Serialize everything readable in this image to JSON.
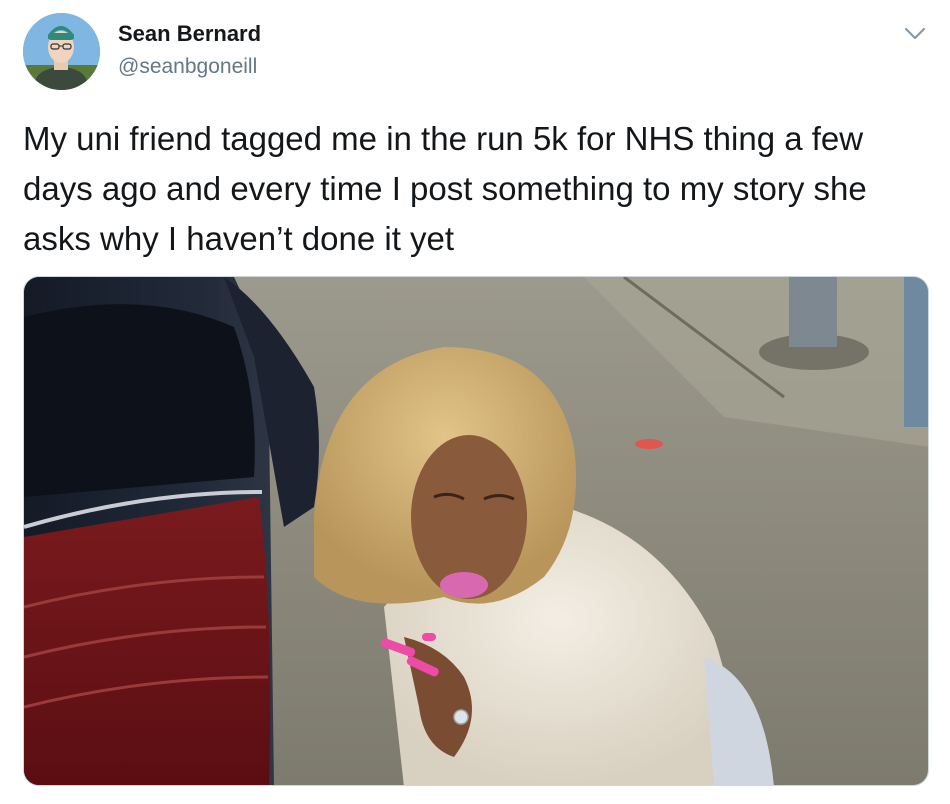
{
  "tweet": {
    "author": {
      "display_name": "Sean Bernard",
      "handle": "@seanbgoneill",
      "avatar_icon": "profile-photo"
    },
    "menu_icon": "chevron-down-icon",
    "text": "My uni friend tagged me in the run 5k for NHS thing a few days ago and every time I post something to my story she asks why I haven’t done it yet",
    "media": {
      "kind": "photo",
      "subject": "woman in blonde wig and white fur coat crouching behind a dark car in a parking lot"
    }
  },
  "colors": {
    "text_primary": "#14171a",
    "text_secondary": "#657786",
    "border": "#ccd6dd",
    "caret": "#8899a6"
  }
}
